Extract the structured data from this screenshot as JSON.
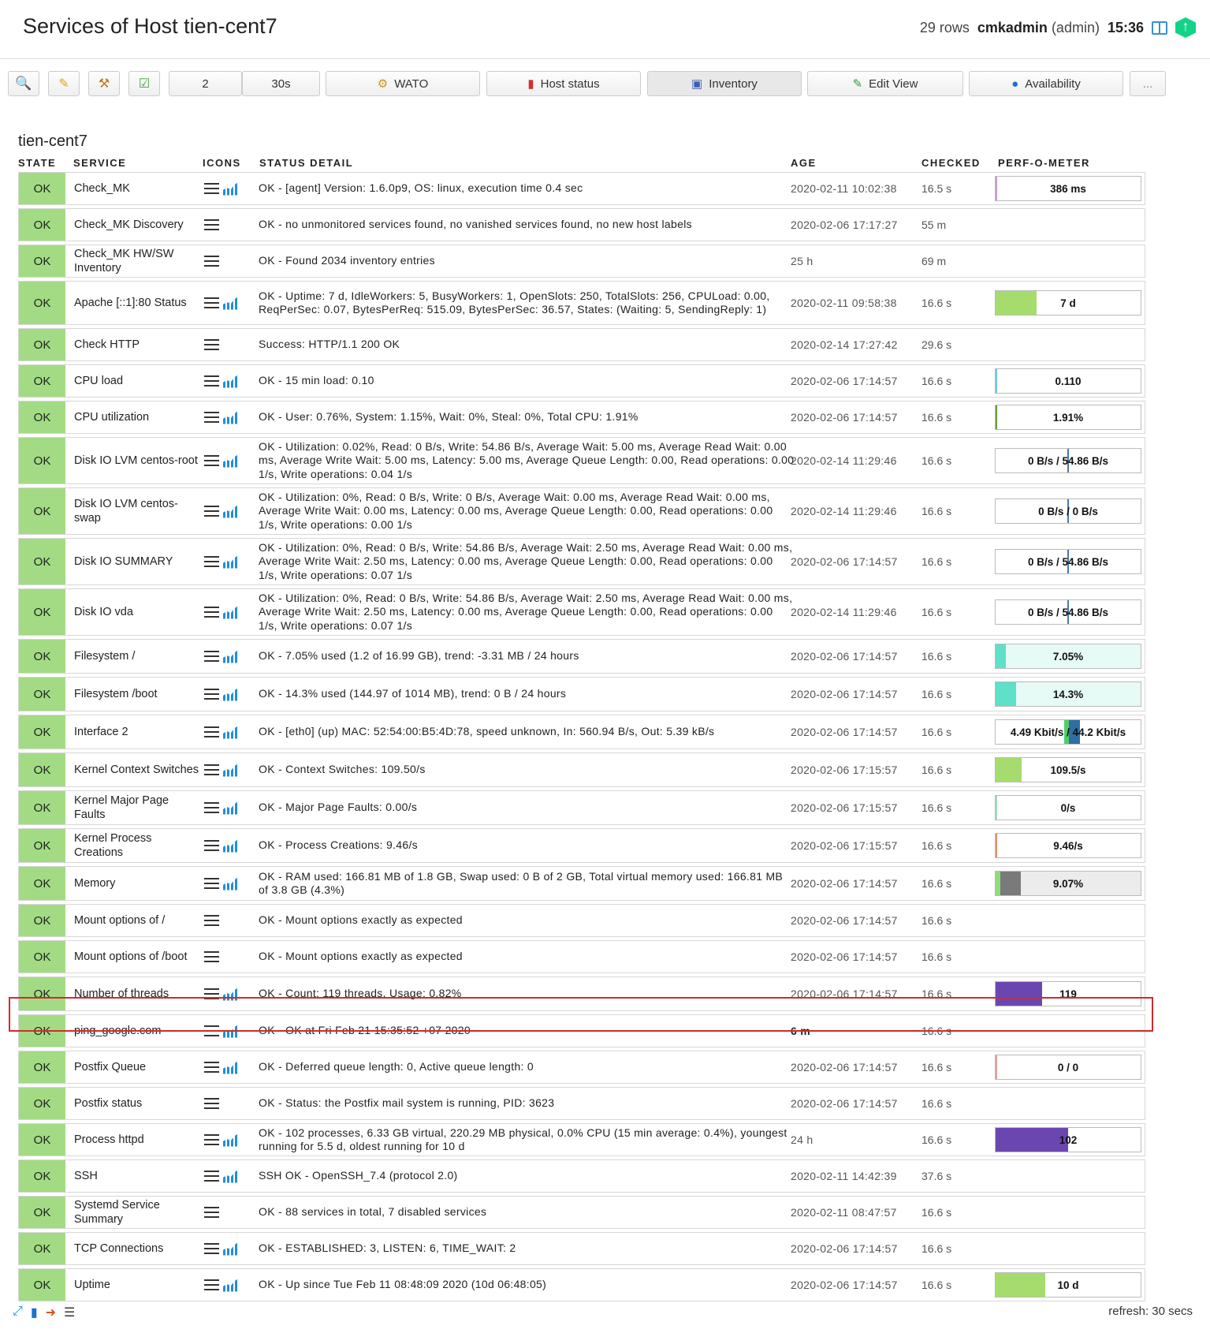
{
  "header": {
    "title": "Services of Host tien-cent7",
    "rows": "29 rows",
    "user": "cmkadmin",
    "role": "(admin)",
    "time": "15:36"
  },
  "toolbar": {
    "refresh_count": "2",
    "refresh_interval": "30s",
    "wato_label": "WATO",
    "host_status_label": "Host status",
    "inventory_label": "Inventory",
    "edit_view_label": "Edit View",
    "availability_label": "Availability",
    "more_label": "..."
  },
  "host": "tien-cent7",
  "columns": {
    "state": "STATE",
    "service": "SERVICE",
    "icons": "ICONS",
    "detail": "STATUS DETAIL",
    "age": "AGE",
    "checked": "CHECKED",
    "perf": "PERF-O-METER"
  },
  "rows": [
    {
      "state": "OK",
      "service": "Check_MK",
      "detail": "OK - [agent] Version: 1.6.0p9, OS: linux, execution time 0.4 sec",
      "age": "2020-02-11 10:02:38",
      "checked": "16.5 s",
      "graph": true,
      "perf": {
        "label": "386 ms",
        "segments": [
          {
            "fraction": 0.01,
            "color": "#c59ad6"
          }
        ]
      }
    },
    {
      "state": "OK",
      "service": "Check_MK Discovery",
      "detail": "OK - no unmonitored services found, no vanished services found, no new host labels",
      "age": "2020-02-06 17:17:27",
      "checked": "55 m",
      "graph": false
    },
    {
      "state": "OK",
      "service": "Check_MK HW/SW Inventory",
      "detail": "OK - Found 2034 inventory entries",
      "age": "25 h",
      "checked": "69 m",
      "graph": false
    },
    {
      "state": "OK",
      "service": "Apache [::1]:80 Status",
      "detail": "OK - Uptime: 7 d, IdleWorkers: 5, BusyWorkers: 1, OpenSlots: 250, TotalSlots: 256, CPULoad: 0.00, ReqPerSec: 0.07, BytesPerReq: 515.09, BytesPerSec: 36.57, States: (Waiting: 5, SendingReply: 1)",
      "age": "2020-02-11 09:58:38",
      "checked": "16.6 s",
      "graph": true,
      "perf": {
        "label": "7 d",
        "segments": [
          {
            "fraction": 0.28,
            "color": "#a6dc6e"
          }
        ]
      }
    },
    {
      "state": "OK",
      "service": "Check HTTP",
      "detail": "Success: HTTP/1.1 200 OK",
      "age": "2020-02-14 17:27:42",
      "checked": "29.6 s",
      "graph": false
    },
    {
      "state": "OK",
      "service": "CPU load",
      "detail": "OK - 15 min load: 0.10",
      "age": "2020-02-06 17:14:57",
      "checked": "16.6 s",
      "graph": true,
      "perf": {
        "label": "0.110",
        "segments": [
          {
            "fraction": 0.01,
            "color": "#6cc6e6"
          }
        ]
      }
    },
    {
      "state": "OK",
      "service": "CPU utilization",
      "detail": "OK - User: 0.76%, System: 1.15%, Wait: 0%, Steal: 0%, Total CPU: 1.91%",
      "age": "2020-02-06 17:14:57",
      "checked": "16.6 s",
      "graph": true,
      "perf": {
        "label": "1.91%",
        "segments": [
          {
            "fraction": 0.01,
            "color": "#6b9a3a"
          }
        ]
      }
    },
    {
      "state": "OK",
      "service": "Disk IO LVM centos-root",
      "detail": "OK - Utilization: 0.02%, Read: 0 B/s, Write: 54.86 B/s, Average Wait: 5.00 ms, Average Read Wait: 0.00 ms, Average Write Wait: 5.00 ms, Latency: 5.00 ms, Average Queue Length: 0.00, Read operations: 0.00 1/s, Write operations: 0.04 1/s",
      "age": "2020-02-14 11:29:46",
      "checked": "16.6 s",
      "graph": true,
      "perf": {
        "label": "0 B/s / 54.86 B/s",
        "divider": true
      }
    },
    {
      "state": "OK",
      "service": "Disk IO LVM centos-swap",
      "detail": "OK - Utilization: 0%, Read: 0 B/s, Write: 0 B/s, Average Wait: 0.00 ms, Average Read Wait: 0.00 ms, Average Write Wait: 0.00 ms, Latency: 0.00 ms, Average Queue Length: 0.00, Read operations: 0.00 1/s, Write operations: 0.00 1/s",
      "age": "2020-02-14 11:29:46",
      "checked": "16.6 s",
      "graph": true,
      "perf": {
        "label": "0 B/s / 0 B/s",
        "divider": true
      }
    },
    {
      "state": "OK",
      "service": "Disk IO SUMMARY",
      "detail": "OK - Utilization: 0%, Read: 0 B/s, Write: 54.86 B/s, Average Wait: 2.50 ms, Average Read Wait: 0.00 ms, Average Write Wait: 2.50 ms, Latency: 0.00 ms, Average Queue Length: 0.00, Read operations: 0.00 1/s, Write operations: 0.07 1/s",
      "age": "2020-02-06 17:14:57",
      "checked": "16.6 s",
      "graph": true,
      "perf": {
        "label": "0 B/s / 54.86 B/s",
        "divider": true
      }
    },
    {
      "state": "OK",
      "service": "Disk IO vda",
      "detail": "OK - Utilization: 0%, Read: 0 B/s, Write: 54.86 B/s, Average Wait: 2.50 ms, Average Read Wait: 0.00 ms, Average Write Wait: 2.50 ms, Latency: 0.00 ms, Average Queue Length: 0.00, Read operations: 0.00 1/s, Write operations: 0.07 1/s",
      "age": "2020-02-14 11:29:46",
      "checked": "16.6 s",
      "graph": true,
      "perf": {
        "label": "0 B/s / 54.86 B/s",
        "divider": true
      }
    },
    {
      "state": "OK",
      "service": "Filesystem /",
      "detail": "OK - 7.05% used (1.2 of 16.99 GB), trend: -3.31 MB / 24 hours",
      "age": "2020-02-06 17:14:57",
      "checked": "16.6 s",
      "graph": true,
      "perf": {
        "label": "7.05%",
        "background": "#e6faf6",
        "segments": [
          {
            "fraction": 0.0705,
            "color": "#5fe0c8"
          }
        ]
      }
    },
    {
      "state": "OK",
      "service": "Filesystem /boot",
      "detail": "OK - 14.3% used (144.97 of 1014 MB), trend: 0 B / 24 hours",
      "age": "2020-02-06 17:14:57",
      "checked": "16.6 s",
      "graph": true,
      "perf": {
        "label": "14.3%",
        "background": "#e6faf6",
        "segments": [
          {
            "fraction": 0.143,
            "color": "#5fe0c8"
          }
        ]
      }
    },
    {
      "state": "OK",
      "service": "Interface 2",
      "detail": "OK - [eth0] (up) MAC: 52:54:00:B5:4D:78, speed unknown, In: 560.94 B/s, Out: 5.39 kB/s",
      "age": "2020-02-06 17:14:57",
      "checked": "16.6 s",
      "graph": true,
      "perf": {
        "label": "4.49 Kbit/s / 44.2 Kbit/s",
        "interface": true
      }
    },
    {
      "state": "OK",
      "service": "Kernel Context Switches",
      "detail": "OK - Context Switches: 109.50/s",
      "age": "2020-02-06 17:15:57",
      "checked": "16.6 s",
      "graph": true,
      "perf": {
        "label": "109.5/s",
        "segments": [
          {
            "fraction": 0.18,
            "color": "#a6dc6e"
          }
        ]
      }
    },
    {
      "state": "OK",
      "service": "Kernel Major Page Faults",
      "detail": "OK - Major Page Faults: 0.00/s",
      "age": "2020-02-06 17:15:57",
      "checked": "16.6 s",
      "graph": true,
      "perf": {
        "label": "0/s",
        "segments": [
          {
            "fraction": 0.01,
            "color": "#a6dcb8"
          }
        ]
      }
    },
    {
      "state": "OK",
      "service": "Kernel Process Creations",
      "detail": "OK - Process Creations: 9.46/s",
      "age": "2020-02-06 17:15:57",
      "checked": "16.6 s",
      "graph": true,
      "perf": {
        "label": "9.46/s",
        "segments": [
          {
            "fraction": 0.01,
            "color": "#d8946a"
          }
        ]
      }
    },
    {
      "state": "OK",
      "service": "Memory",
      "detail": "OK - RAM used: 166.81 MB of 1.8 GB, Swap used: 0 B of 2 GB, Total virtual memory used: 166.81 MB of 3.8 GB (4.3%)",
      "age": "2020-02-06 17:14:57",
      "checked": "16.6 s",
      "graph": true,
      "perf": {
        "label": "9.07%",
        "background": "#ececec",
        "segments": [
          {
            "fraction": 0.03,
            "color": "#8fdc7a"
          },
          {
            "fraction": 0.14,
            "color": "#7a7a7a"
          }
        ]
      }
    },
    {
      "state": "OK",
      "service": "Mount options of /",
      "detail": "OK - Mount options exactly as expected",
      "age": "2020-02-06 17:14:57",
      "checked": "16.6 s",
      "graph": false
    },
    {
      "state": "OK",
      "service": "Mount options of /boot",
      "detail": "OK - Mount options exactly as expected",
      "age": "2020-02-06 17:14:57",
      "checked": "16.6 s",
      "graph": false
    },
    {
      "state": "OK",
      "service": "Number of threads",
      "detail": "OK - Count: 119 threads, Usage: 0.82%",
      "age": "2020-02-06 17:14:57",
      "checked": "16.6 s",
      "graph": true,
      "perf": {
        "label": "119",
        "segments": [
          {
            "fraction": 0.32,
            "color": "#6a47b0"
          }
        ]
      }
    },
    {
      "state": "OK",
      "service": "ping_google.com",
      "detail": "OK - OK at Fri Feb 21 15:35:52 +07 2020",
      "age": "6 m",
      "age_bold": true,
      "checked": "16.6 s",
      "graph": true
    },
    {
      "state": "OK",
      "service": "Postfix Queue",
      "detail": "OK - Deferred queue length: 0, Active queue length: 0",
      "age": "2020-02-06 17:14:57",
      "checked": "16.6 s",
      "graph": true,
      "perf": {
        "label": "0 / 0",
        "segments": [
          {
            "fraction": 0.01,
            "color": "#e0a0a0"
          }
        ]
      }
    },
    {
      "state": "OK",
      "service": "Postfix status",
      "detail": "OK - Status: the Postfix mail system is running, PID: 3623",
      "age": "2020-02-06 17:14:57",
      "checked": "16.6 s",
      "graph": false
    },
    {
      "state": "OK",
      "service": "Process httpd",
      "detail": "OK - 102 processes, 6.33 GB virtual, 220.29 MB physical, 0.0% CPU (15 min average: 0.4%), youngest running for 5.5 d, oldest running for 10 d",
      "age": "24 h",
      "checked": "16.6 s",
      "graph": true,
      "perf": {
        "label": "102",
        "segments": [
          {
            "fraction": 0.5,
            "color": "#6a47b0"
          }
        ]
      }
    },
    {
      "state": "OK",
      "service": "SSH",
      "detail": "SSH OK - OpenSSH_7.4 (protocol 2.0)",
      "age": "2020-02-11 14:42:39",
      "checked": "37.6 s",
      "graph": true
    },
    {
      "state": "OK",
      "service": "Systemd Service Summary",
      "detail": "OK - 88 services in total, 7 disabled services",
      "age": "2020-02-11 08:47:57",
      "checked": "16.6 s",
      "graph": false
    },
    {
      "state": "OK",
      "service": "TCP Connections",
      "detail": "OK - ESTABLISHED: 3, LISTEN: 6, TIME_WAIT: 2",
      "age": "2020-02-06 17:14:57",
      "checked": "16.6 s",
      "graph": true
    },
    {
      "state": "OK",
      "service": "Uptime",
      "detail": "OK - Up since Tue Feb 11 08:48:09 2020 (10d 06:48:05)",
      "age": "2020-02-06 17:14:57",
      "checked": "16.6 s",
      "graph": true,
      "perf": {
        "label": "10 d",
        "segments": [
          {
            "fraction": 0.34,
            "color": "#a6dc6e"
          }
        ]
      }
    }
  ],
  "footer": {
    "refresh": "refresh: 30 secs"
  }
}
